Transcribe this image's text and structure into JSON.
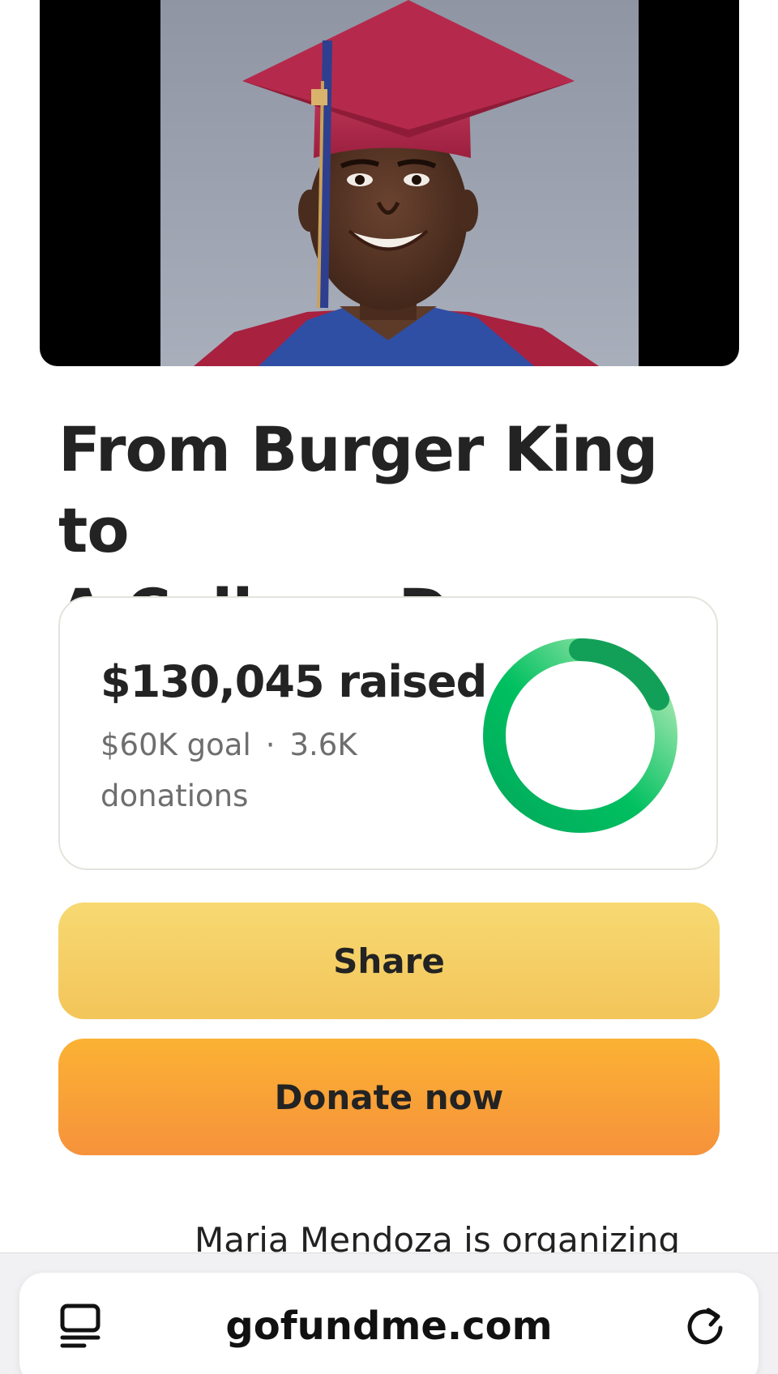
{
  "campaign": {
    "title_line1": "From Burger King to",
    "title_line2": "A College Dream",
    "hero_image": "graduate-portrait-photo"
  },
  "progress": {
    "raised_text": "$130,045 raised",
    "goal_text": "$60K goal",
    "separator": "·",
    "donations_count": "3.6K",
    "donations_label": "donations",
    "percent_of_goal": 100,
    "ring_colors": {
      "start": "#02a95c",
      "mid": "#00c060",
      "end": "#c8f0c0"
    }
  },
  "actions": {
    "share_label": "Share",
    "donate_label": "Donate now",
    "share_color": "#f5cf66",
    "donate_color": "#f8a237"
  },
  "organizer": {
    "text": "Maria Mendoza is organizing"
  },
  "browser": {
    "url": "gofundme.com",
    "tabs_icon": "tabs-icon",
    "reload_icon": "reload-icon"
  }
}
